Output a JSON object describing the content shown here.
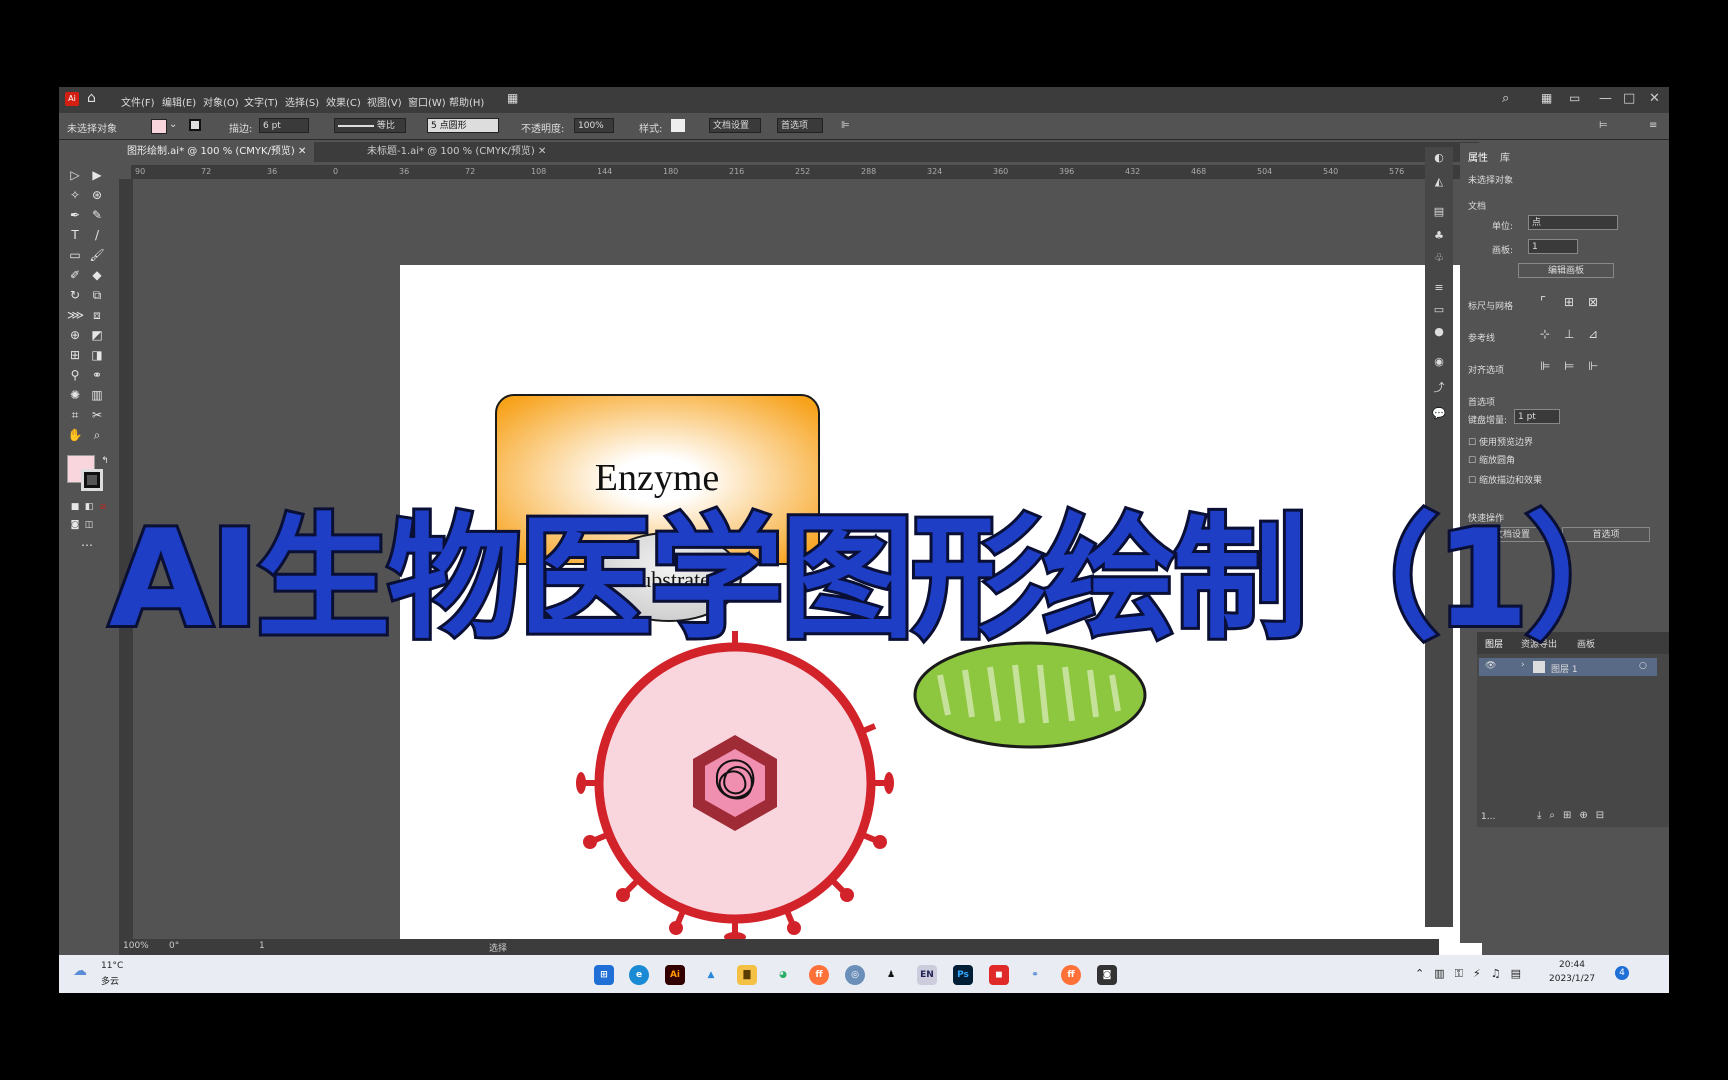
{
  "app": {
    "logo": "Ai",
    "menus": [
      "文件(F)",
      "编辑(E)",
      "对象(O)",
      "文字(T)",
      "选择(S)",
      "效果(C)",
      "视图(V)",
      "窗口(W)",
      "帮助(H)"
    ],
    "window_controls": [
      "—",
      "□",
      "✕"
    ]
  },
  "control_bar": {
    "no_selection": "未选择对象",
    "stroke_label": "描边:",
    "stroke_value": "6 pt",
    "stroke_style": "等比",
    "brush": "5 点圆形",
    "opacity_label": "不透明度:",
    "opacity_value": "100%",
    "style_label": "样式:",
    "doc_setup": "文档设置",
    "preferences": "首选项"
  },
  "tabs": [
    {
      "label": "图形绘制.ai* @ 100 % (CMYK/预览)",
      "active": true
    },
    {
      "label": "未标题-1.ai* @ 100 % (CMYK/预览)",
      "active": false
    }
  ],
  "ruler_ticks": [
    "90",
    "72",
    "36",
    "0",
    "36",
    "72",
    "108",
    "144",
    "180",
    "216",
    "252",
    "288",
    "324",
    "360",
    "396",
    "432",
    "468",
    "504",
    "540",
    "576"
  ],
  "artwork": {
    "enzyme_label": "Enzyme",
    "substrate_label": "Substrate",
    "colors": {
      "enzyme_fill_center": "#ffffff",
      "enzyme_fill_edge": "#f7a21b",
      "virus_body": "#f9d5de",
      "virus_outline": "#d2232a",
      "hexagon": "#9e2b35",
      "hexagon_inner": "#f18fb1",
      "mitochondria": "#8dc63f"
    }
  },
  "properties_panel": {
    "tab_properties": "属性",
    "tab_layers_short": "库",
    "no_selection": "未选择对象",
    "document_label": "文档",
    "units_label": "单位:",
    "units_value": "点",
    "artboard_label": "画板:",
    "artboard_value": "1",
    "edit_artboard": "编辑画板",
    "rulers_grids": "标尺与网格",
    "guides": "参考线",
    "snap_options": "对齐选项",
    "preferences_label": "首选项",
    "keyboard_increment_label": "键盘增量:",
    "keyboard_increment_value": "1 pt",
    "checkbox_preview_bounds": "使用预览边界",
    "checkbox_scale_corners": "缩放圆角",
    "checkbox_scale_strokes": "缩放描边和效果",
    "quick_actions": "快速操作",
    "quick_btn_1": "文档设置",
    "quick_btn_2": "首选项"
  },
  "layers_panel": {
    "tabs": [
      "图层",
      "资源导出",
      "画板"
    ],
    "layer_name": "图层 1",
    "count": "1..."
  },
  "status_bar": {
    "zoom": "100%",
    "rotation": "0°",
    "artboard_num": "1",
    "tool": "选择"
  },
  "taskbar": {
    "weather_temp": "11°C",
    "weather_desc": "多云",
    "time": "20:44",
    "date": "2023/1/27",
    "notification_count": "4"
  },
  "overlay_title": "AI生物医学图形绘制（1）"
}
